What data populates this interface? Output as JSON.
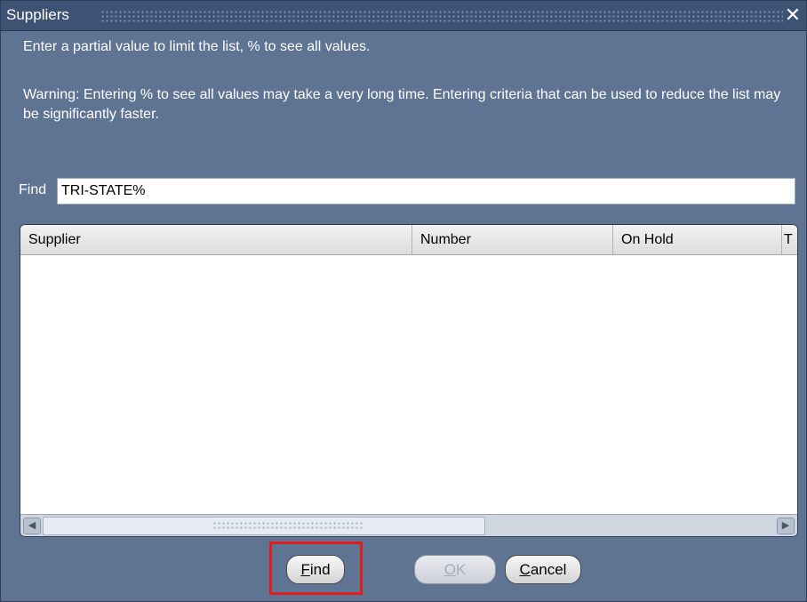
{
  "window": {
    "title": "Suppliers",
    "close_glyph": "✕"
  },
  "messages": {
    "instruction": "Enter a partial value to limit the list, % to see all values.",
    "warning": "Warning: Entering % to see all values may take a very long time. Entering criteria that can be used to reduce the list may be significantly faster."
  },
  "find": {
    "label": "Find",
    "value": "TRI-STATE%"
  },
  "table": {
    "columns": [
      "Supplier",
      "Number",
      "On Hold",
      "T"
    ],
    "rows": []
  },
  "buttons": {
    "find": {
      "mnemonic": "F",
      "rest": "ind"
    },
    "ok": {
      "mnemonic": "O",
      "rest": "K",
      "enabled": false
    },
    "cancel": {
      "mnemonic": "C",
      "rest": "ancel"
    }
  },
  "icons": {
    "close": "close-icon",
    "scroll_left": "scroll-left-arrow-icon",
    "scroll_right": "scroll-right-arrow-icon"
  },
  "colors": {
    "window_bg": "#5f7393",
    "titlebar_bg": "#3e5274",
    "highlight": "#e21b1b"
  }
}
